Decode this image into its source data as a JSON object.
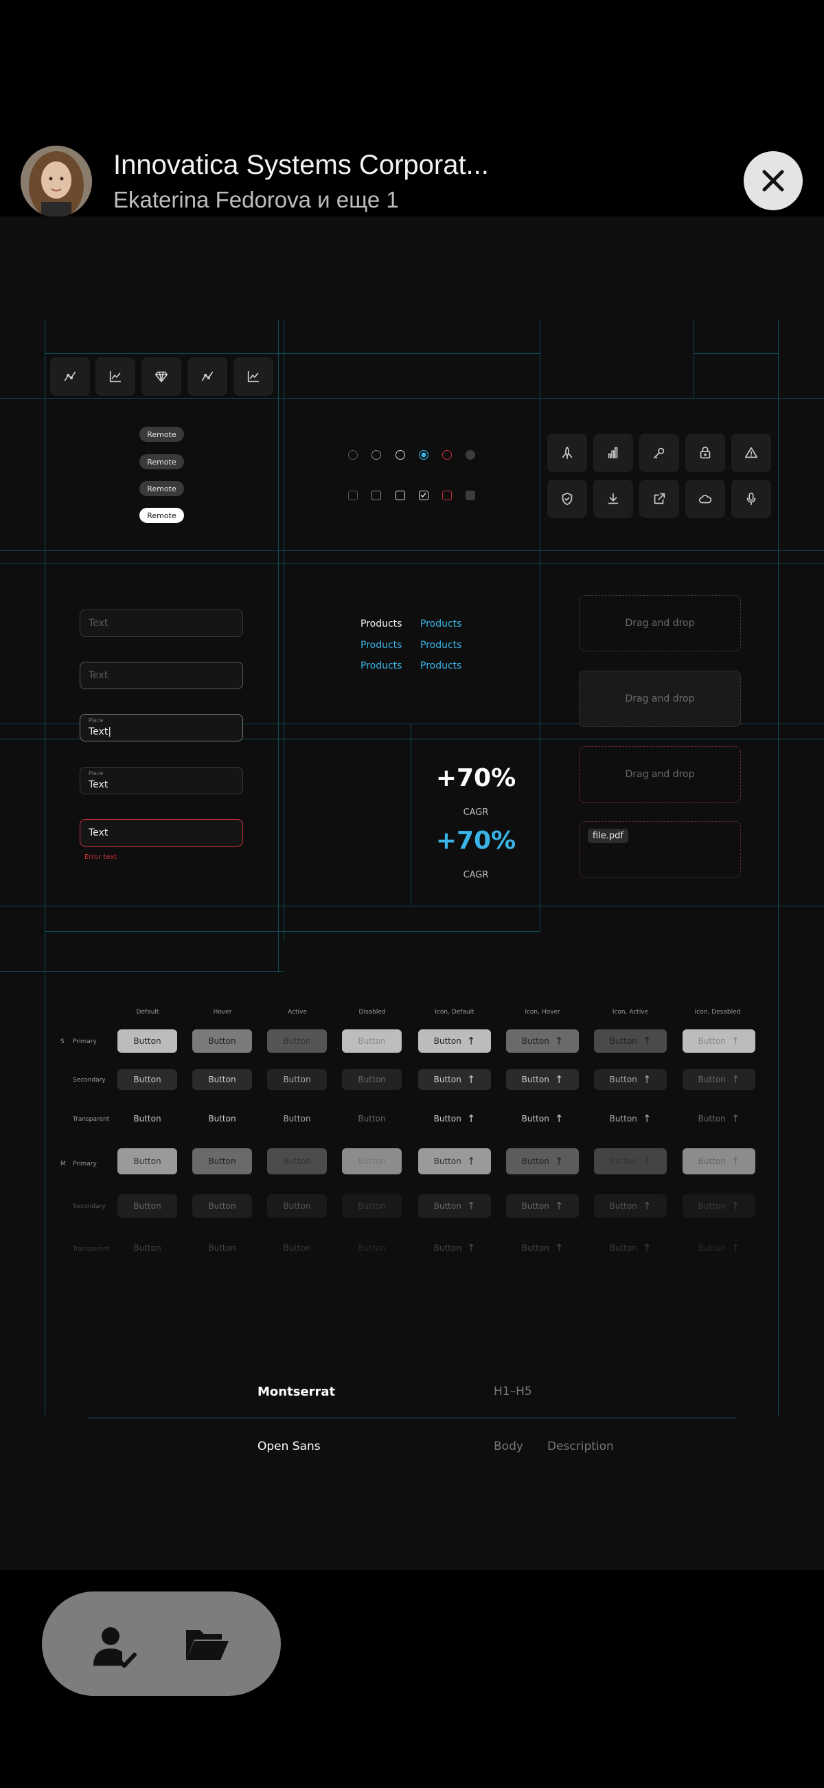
{
  "header": {
    "title": "Innovatica Systems Corporat...",
    "subtitle": "Ekaterina Fedorova и еще 1"
  },
  "chips": [
    "Remote",
    "Remote",
    "Remote",
    "Remote"
  ],
  "inputs": {
    "placeholder_1": "Text",
    "placeholder_2": "Text",
    "focused_label": "Place",
    "focused_value": "Text|",
    "filled_label": "Place",
    "filled_value": "Text",
    "error_value": "Text",
    "error_text": "Error text"
  },
  "products": [
    "Products",
    "Products",
    "Products",
    "Products",
    "Products",
    "Products"
  ],
  "dropzones": {
    "label": "Drag and drop",
    "file_name": "file.pdf"
  },
  "stats": {
    "value_white": "+70%",
    "label_1": "CAGR",
    "value_blue": "+70%",
    "label_2": "CAGR"
  },
  "button_table": {
    "columns": [
      "Default",
      "Hover",
      "Active",
      "Disabled",
      "Icon, Default",
      "Icon, Hover",
      "Icon, Active",
      "Icon, Desabled"
    ],
    "sizes": [
      "S",
      "M"
    ],
    "rows": [
      "Primary",
      "Secondary",
      "Transparent",
      "Primary",
      "Secondary",
      "Transparent"
    ],
    "button_label": "Button"
  },
  "typography": {
    "font_1": "Montserrat",
    "font_1_use": "H1–H5",
    "font_2": "Open Sans",
    "font_2_use_1": "Body",
    "font_2_use_2": "Description"
  },
  "colors": {
    "accent": "#3ab4e6",
    "error": "#c8323c",
    "guide": "#0f4b5a"
  },
  "dock_icons": [
    "user-check-icon",
    "folder-icon"
  ]
}
